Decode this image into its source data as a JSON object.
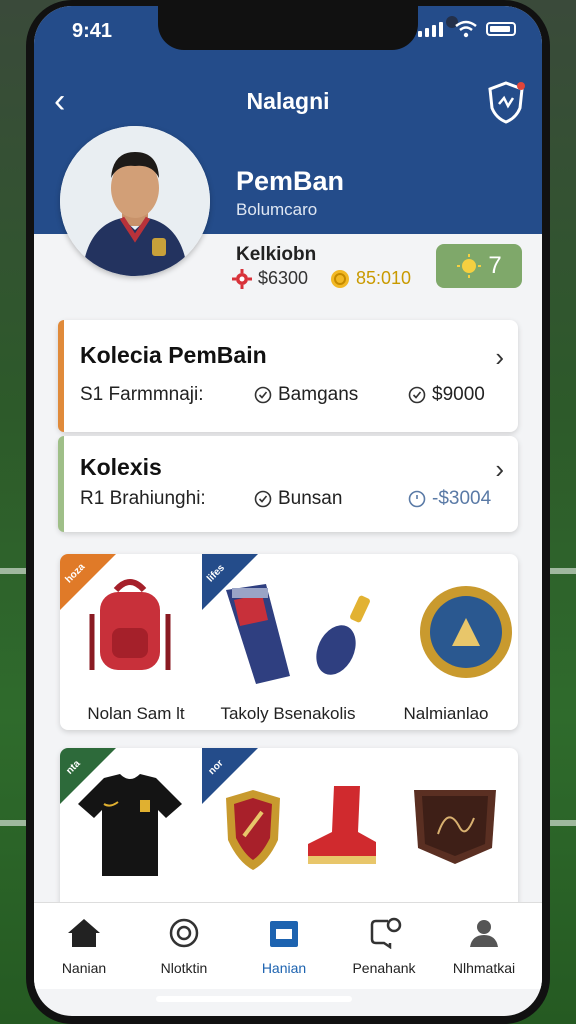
{
  "status_bar": {
    "time": "9:41"
  },
  "header": {
    "title": "Nalagni"
  },
  "player": {
    "name": "PemBan",
    "subtitle": "Bolumcaro"
  },
  "stats": {
    "label": "Kelkiobn",
    "stat1": "$6300",
    "stat2": "85:010",
    "badge_value": "7"
  },
  "cards": [
    {
      "title": "Kolecia PemBain",
      "left": "S1 Farmmnaji:",
      "mid": "Bamgans",
      "right": "$9000",
      "accent": "#e08a3a"
    },
    {
      "title": "Kolexis",
      "left": "R1 Brahiunghi:",
      "mid": "Bunsan",
      "right": "-$3004",
      "accent": "#9fbf88"
    }
  ],
  "grid1": {
    "corner1": "hoza",
    "corner2": "lifes",
    "labels": [
      "Nolan Sam lt",
      "Takoly Bsenakolis",
      "Nalmianlao"
    ]
  },
  "grid2": {
    "corner1": "nta",
    "corner2": "nor"
  },
  "nav": [
    {
      "label": "Nanian",
      "icon": "home-icon"
    },
    {
      "label": "Nlotktin",
      "icon": "target-icon"
    },
    {
      "label": "Hanian",
      "icon": "store-icon"
    },
    {
      "label": "Penahank",
      "icon": "chat-icon"
    },
    {
      "label": "Nlhmatkai",
      "icon": "profile-icon"
    }
  ],
  "colors": {
    "header": "#244c8a",
    "active": "#1d63b0",
    "badge": "#7fa86a"
  }
}
